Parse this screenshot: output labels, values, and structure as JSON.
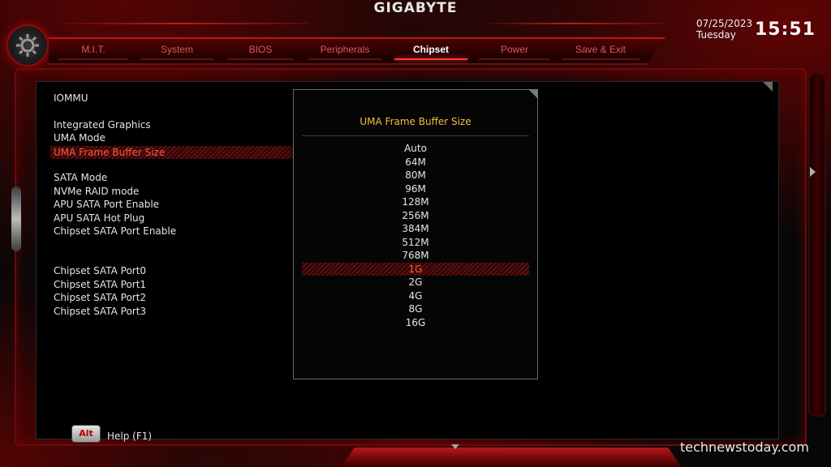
{
  "header": {
    "brand": "GIGABYTE",
    "date": "07/25/2023",
    "day": "Tuesday",
    "time": "15:51"
  },
  "tabs": [
    {
      "label": "M.I.T.",
      "active": false
    },
    {
      "label": "System",
      "active": false
    },
    {
      "label": "BIOS",
      "active": false
    },
    {
      "label": "Peripherals",
      "active": false
    },
    {
      "label": "Chipset",
      "active": true
    },
    {
      "label": "Power",
      "active": false
    },
    {
      "label": "Save & Exit",
      "active": false
    }
  ],
  "settings": {
    "items": [
      "IOMMU",
      "Integrated Graphics",
      "UMA Mode",
      "UMA Frame Buffer Size",
      "SATA Mode",
      "NVMe RAID mode",
      "APU SATA Port Enable",
      "APU SATA Hot Plug",
      "Chipset SATA Port Enable",
      "Chipset SATA Port0",
      "Chipset SATA Port1",
      "Chipset SATA Port2",
      "Chipset SATA Port3"
    ],
    "highlighted": "UMA Frame Buffer Size"
  },
  "popup": {
    "title": "UMA Frame Buffer Size",
    "options": [
      "Auto",
      "64M",
      "80M",
      "96M",
      "128M",
      "256M",
      "384M",
      "512M",
      "768M",
      "1G",
      "2G",
      "4G",
      "8G",
      "16G"
    ],
    "selected": "1G"
  },
  "footer": {
    "alt_key": "Alt",
    "help": "Help (F1)",
    "watermark": "technewstoday.com"
  },
  "icons": {
    "gear": "gear-icon",
    "scroll_down": "chevron-down-icon",
    "side_arrow": "chevron-right-icon"
  },
  "colors": {
    "accent": "#c21a1a",
    "highlight_text": "#ff5a40",
    "popup_title": "#f0c040"
  }
}
